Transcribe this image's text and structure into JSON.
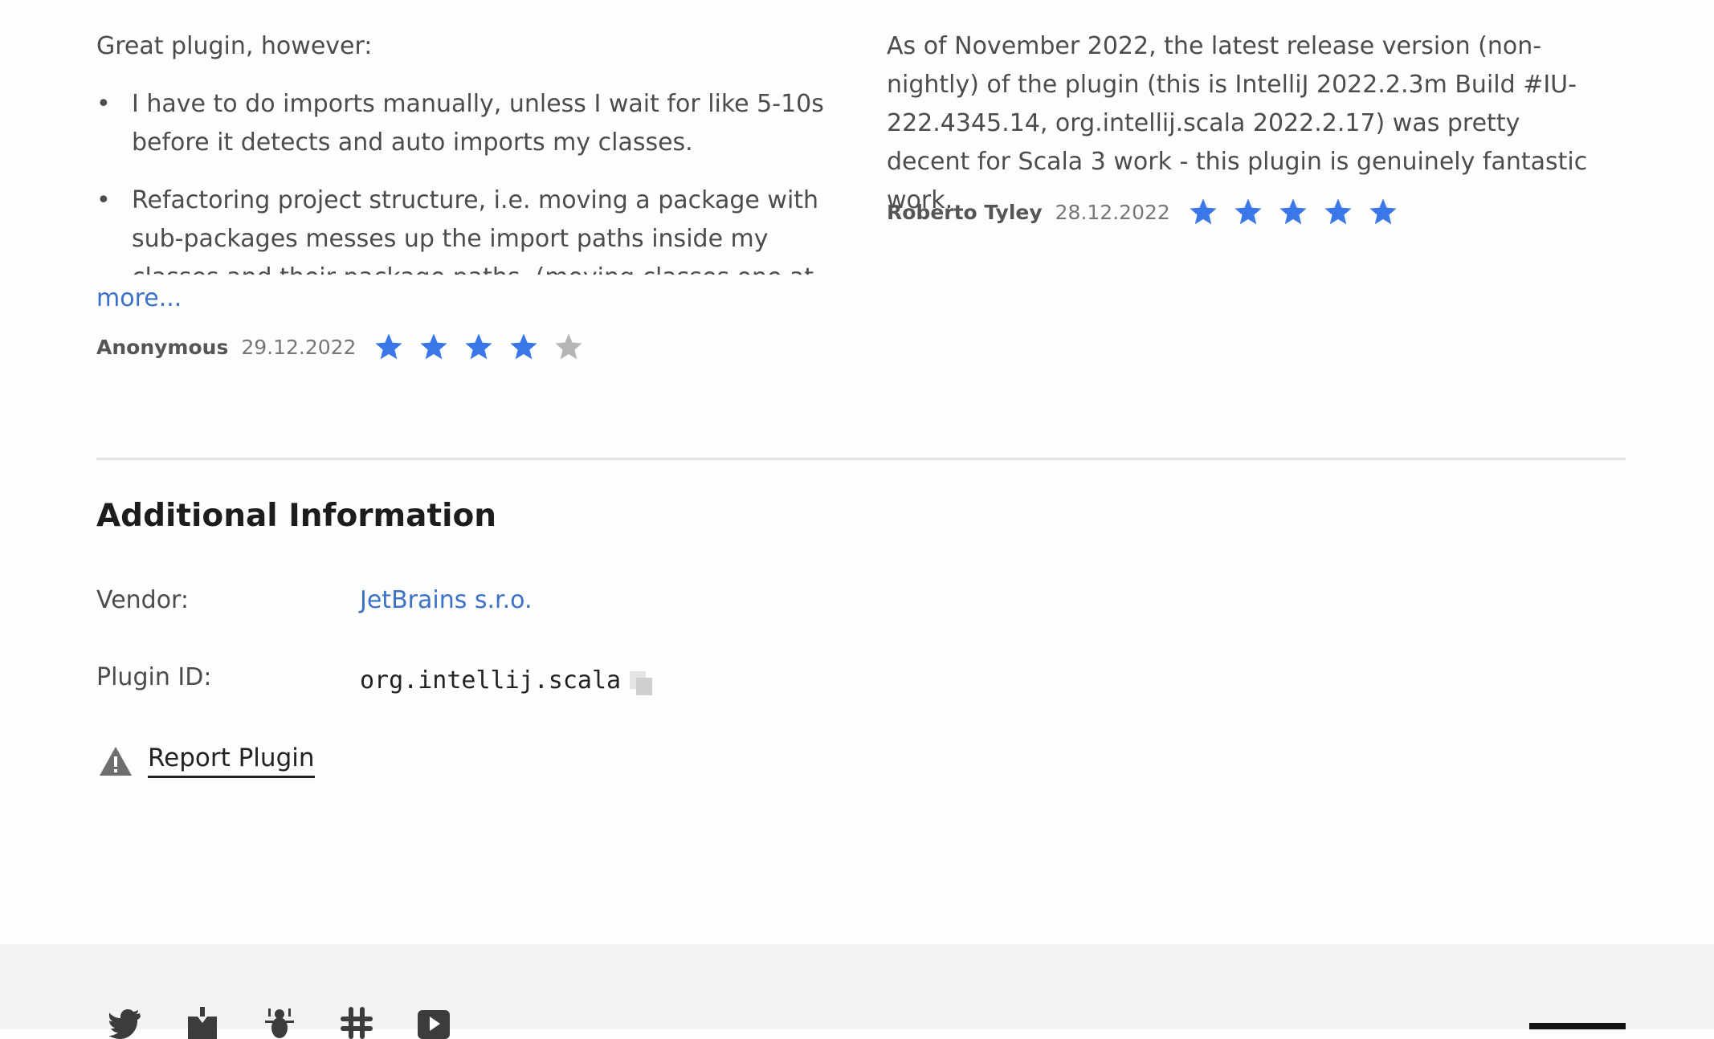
{
  "reviews": [
    {
      "intro": "Great plugin, however:",
      "bullets": [
        "I have to do imports manually, unless I wait for like 5-10s before it detects and auto imports my classes.",
        "Refactoring project structure, i.e. moving a package with sub-packages messes up the import paths inside my classes and their package paths. (moving classes one at a"
      ],
      "more_label": "more...",
      "author": "Anonymous",
      "date": "29.12.2022",
      "rating": 4
    },
    {
      "text": "As of November 2022, the latest release version (non-nightly) of the plugin (this is IntelliJ 2022.2.3m Build #IU-222.4345.14, org.intellij.scala 2022.2.17) was pretty decent for Scala 3 work - this plugin is genuinely fantastic work.",
      "author": "Roberto Tyley",
      "date": "28.12.2022",
      "rating": 5
    }
  ],
  "additional_info": {
    "title": "Additional Information",
    "vendor_label": "Vendor:",
    "vendor_value": "JetBrains s.r.o.",
    "plugin_id_label": "Plugin ID:",
    "plugin_id_value": "org.intellij.scala",
    "report_label": "Report Plugin"
  },
  "icons": {
    "bullet": "•",
    "star": "star-icon",
    "copy": "copy-icon",
    "warning": "warning-icon",
    "social": [
      "twitter-icon",
      "blog-icon",
      "bug-icon",
      "slack-icon",
      "youtube-icon"
    ]
  },
  "colors": {
    "star_filled": "#3b78e7",
    "star_empty": "#b5b5b5",
    "link": "#3b72c7",
    "footer_bg": "#f3f3f3"
  }
}
